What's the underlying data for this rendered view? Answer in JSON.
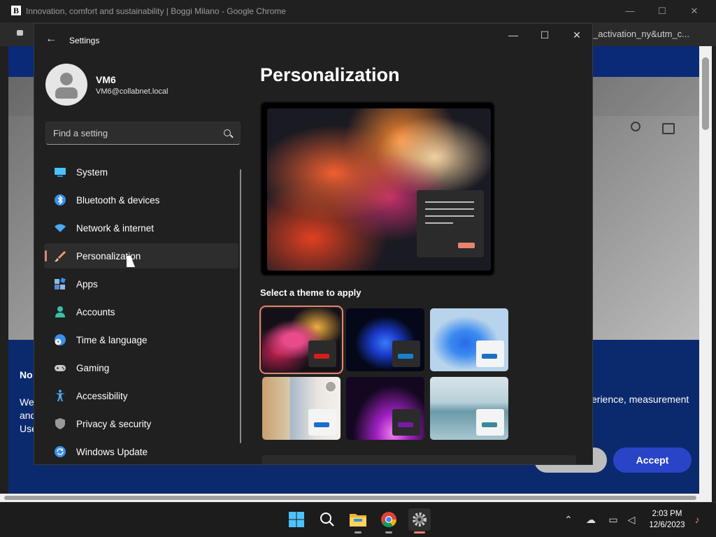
{
  "chrome": {
    "favicon_letter": "B",
    "title": "Innovation, comfort and sustainability | Boggi Milano - Google Chrome",
    "minimize": "—",
    "maximize": "☐",
    "close": "✕",
    "url_fragment": "_activation_ny&utm_c..."
  },
  "webpage": {
    "cookie_title": "No",
    "cookie_text_left": "We and Use",
    "cookie_text_right": "erience, measurement",
    "accept_label": "Accept"
  },
  "settings": {
    "window_title": "Settings",
    "minimize": "—",
    "maximize": "☐",
    "close": "✕",
    "profile": {
      "name": "VM6",
      "email": "VM6@collabnet.local"
    },
    "search_placeholder": "Find a setting",
    "nav": [
      {
        "label": "System",
        "icon": "system-icon",
        "color": "#4cc2ff"
      },
      {
        "label": "Bluetooth & devices",
        "icon": "bluetooth-icon",
        "color": "#3a8fe8"
      },
      {
        "label": "Network & internet",
        "icon": "wifi-icon",
        "color": "#4ca8f0"
      },
      {
        "label": "Personalization",
        "icon": "paintbrush-icon",
        "color": "#e8a070",
        "selected": true
      },
      {
        "label": "Apps",
        "icon": "apps-icon",
        "color": "#8fb8e8"
      },
      {
        "label": "Accounts",
        "icon": "accounts-icon",
        "color": "#36c2a8"
      },
      {
        "label": "Time & language",
        "icon": "globe-clock-icon",
        "color": "#3a8fe8"
      },
      {
        "label": "Gaming",
        "icon": "gamepad-icon",
        "color": "#c8c8c8"
      },
      {
        "label": "Accessibility",
        "icon": "accessibility-icon",
        "color": "#4ca8f0"
      },
      {
        "label": "Privacy & security",
        "icon": "shield-icon",
        "color": "#9a9a9a"
      },
      {
        "label": "Windows Update",
        "icon": "update-icon",
        "color": "#3a8fe8"
      }
    ],
    "page_title": "Personalization",
    "theme_heading": "Select a theme to apply",
    "themes": [
      {
        "name": "glow-dark",
        "accent": "#d81c1c",
        "selected": true
      },
      {
        "name": "bloom-dark",
        "accent": "#1a7fd4"
      },
      {
        "name": "bloom-light",
        "accent": "#1a6fc8"
      },
      {
        "name": "captured-motion",
        "accent": "#1a6fc8"
      },
      {
        "name": "sunrise",
        "accent": "#7a1aa8"
      },
      {
        "name": "flow",
        "accent": "#3a8a9a"
      }
    ],
    "accent_color": "#e8836e"
  },
  "taskbar": {
    "apps": [
      {
        "name": "start",
        "icon": "windows-logo-icon"
      },
      {
        "name": "search",
        "icon": "search-icon"
      },
      {
        "name": "file-explorer",
        "icon": "folder-icon"
      },
      {
        "name": "chrome",
        "icon": "chrome-icon"
      },
      {
        "name": "settings",
        "icon": "gear-icon",
        "active": true
      }
    ],
    "time": "2:03 PM",
    "date": "12/6/2023"
  }
}
